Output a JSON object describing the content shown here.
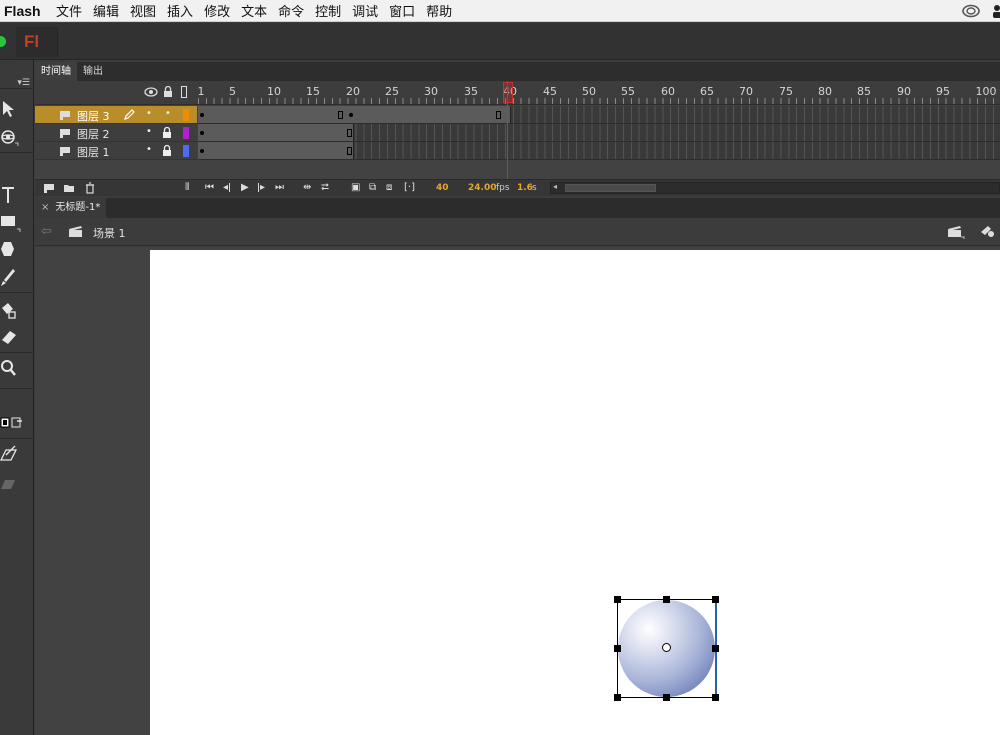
{
  "menubar": {
    "app_name": "Flash",
    "items": [
      "文件",
      "编辑",
      "视图",
      "插入",
      "修改",
      "文本",
      "命令",
      "控制",
      "调试",
      "窗口",
      "帮助"
    ]
  },
  "app": {
    "logo": "Fl",
    "brand_color": "#c4401f"
  },
  "timeline": {
    "tabs": [
      "时间轴",
      "输出"
    ],
    "ruler": [
      "1",
      "5",
      "10",
      "15",
      "20",
      "25",
      "30",
      "35",
      "40",
      "45",
      "50",
      "55",
      "60",
      "65",
      "70",
      "75",
      "80",
      "85",
      "90",
      "95",
      "100"
    ],
    "layers": [
      {
        "name": "图层 3",
        "selected": true,
        "color": "#f08c00",
        "span_end": 40
      },
      {
        "name": "图层 2",
        "selected": false,
        "color": "#b020d0",
        "span_end": 20
      },
      {
        "name": "图层 1",
        "selected": false,
        "color": "#4a6cf0",
        "span_end": 20
      }
    ],
    "current_frame": 40,
    "footer": {
      "frame": "40",
      "fps_value": "24.00",
      "fps_unit": "fps",
      "time_value": "1.6",
      "time_unit": "s"
    }
  },
  "document": {
    "tab_close": "×",
    "tab_title": "无标题-1*"
  },
  "edit_bar": {
    "scene_label": "场景 1"
  },
  "stage": {
    "background": "#ffffff",
    "object": "gradient-circle"
  }
}
